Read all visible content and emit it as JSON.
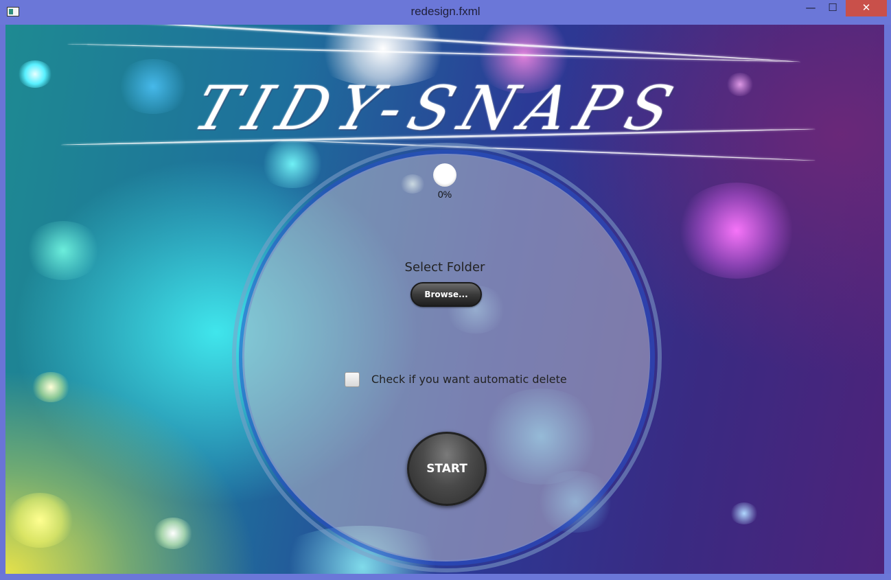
{
  "window": {
    "title": "redesign.fxml",
    "controls": {
      "minimize": "—",
      "maximize": "☐",
      "close": "✕"
    }
  },
  "logo": {
    "text": "TIDY-SNAPS"
  },
  "progress": {
    "value": 0,
    "label": "0%"
  },
  "folder": {
    "label": "Select Folder",
    "browse_label": "Browse..."
  },
  "auto_delete": {
    "checked": false,
    "label": "Check if you want automatic delete"
  },
  "start": {
    "label": "START"
  },
  "colors": {
    "titlebar": "#6b77d8",
    "close_button": "#c9504a",
    "button_dark": "#2a2a2a",
    "disk": "#b9b9c8"
  }
}
